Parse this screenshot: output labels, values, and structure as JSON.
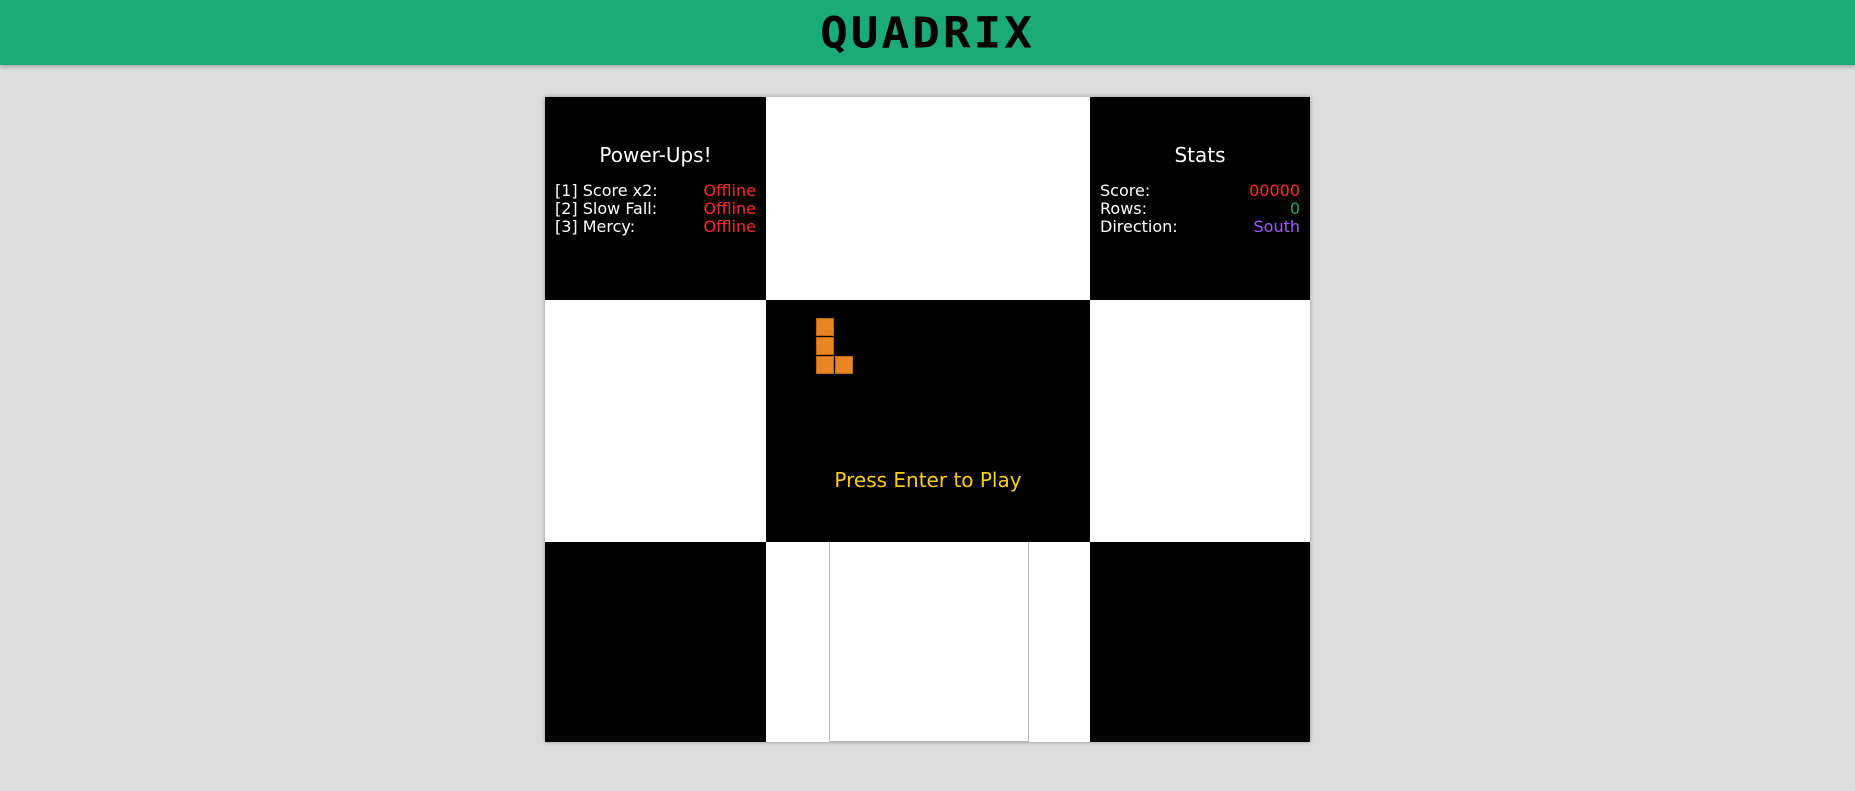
{
  "header": {
    "title": "QUADRIX",
    "background_color": "#1aab78"
  },
  "powerups": {
    "title": "Power-Ups!",
    "items": [
      {
        "label": "[1] Score x2:",
        "status": "Offline"
      },
      {
        "label": "[2] Slow Fall:",
        "status": "Offline"
      },
      {
        "label": "[3] Mercy:",
        "status": "Offline"
      }
    ]
  },
  "stats": {
    "title": "Stats",
    "score_label": "Score:",
    "score_value": "00000",
    "rows_label": "Rows:",
    "rows_value": "0",
    "direction_label": "Direction:",
    "direction_value": "South"
  },
  "game": {
    "prompt": "Press Enter to Play",
    "prompt_color": "#ffcc14",
    "piece_color": "#e88524",
    "piece_type": "L"
  },
  "colors": {
    "status_offline": "#ff2a2a",
    "rows_value": "#1aab5a",
    "direction_value": "#a05cff"
  }
}
